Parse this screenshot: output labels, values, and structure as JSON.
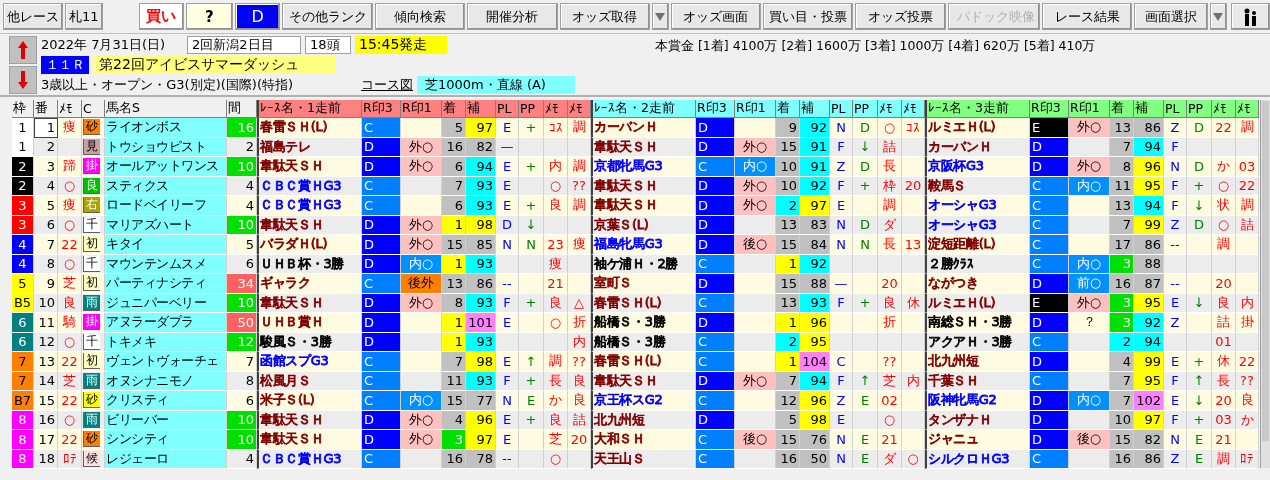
{
  "toolbar": {
    "buttons": [
      {
        "label": "他レース",
        "kind": "nav",
        "disabled": false
      },
      {
        "label": "札11",
        "kind": "nav",
        "disabled": false
      },
      {
        "label": "買い",
        "kind": "buy",
        "disabled": false
      },
      {
        "label": "?",
        "kind": "query",
        "disabled": false
      },
      {
        "label": "D",
        "kind": "rank",
        "disabled": false
      },
      {
        "label": "その他ランク",
        "kind": "wide",
        "disabled": false
      },
      {
        "label": "傾向検索",
        "kind": "wide",
        "disabled": false
      },
      {
        "label": "開催分析",
        "kind": "wide",
        "disabled": false
      },
      {
        "label": "オッズ取得",
        "kind": "wide",
        "disabled": false
      },
      {
        "kind": "dropdown",
        "disabled": false
      },
      {
        "label": "オッズ画面",
        "kind": "wide",
        "disabled": false
      },
      {
        "label": "買い目・投票",
        "kind": "wide",
        "disabled": false
      },
      {
        "label": "オッズ投票",
        "kind": "wide",
        "disabled": false
      },
      {
        "label": "パドック映像",
        "kind": "video",
        "disabled": true
      },
      {
        "label": "レース結果",
        "kind": "wide",
        "disabled": false
      },
      {
        "label": "画面選択",
        "kind": "select",
        "disabled": false
      },
      {
        "kind": "dropdown",
        "disabled": false
      },
      {
        "kind": "icon",
        "disabled": false
      }
    ]
  },
  "race": {
    "date": "2022年 7月31日(日)",
    "meeting": "2回新潟2日目",
    "runners": "18頭",
    "post_time": "15:45発走",
    "number": "１１Ｒ",
    "title": "第22回アイビスサマーダッシュ",
    "conditions": "3歳以上・オープン・G3(別定)(国際)(特指)",
    "course_link": "コース図",
    "course": "芝1000m・直線 (A)",
    "prize": "本賞金 [1着] 4100万 [2着] 1600万 [3着] 1000万 [4着] 620万 [5着] 410万"
  },
  "table": {
    "columns": [
      "枠",
      "番",
      "ﾒﾓ",
      "C",
      "馬名S",
      "間"
    ],
    "blocks": [
      {
        "color": "#ff8080",
        "columns": [
          "ﾚｰｽ名・1走前",
          "R印3",
          "R印1",
          "着",
          "補",
          "PL",
          "PP",
          "ﾒﾓ",
          "ﾒﾓ"
        ]
      },
      {
        "color": "#80ffff",
        "columns": [
          "ﾚｰｽ名・2走前",
          "R印3",
          "R印1",
          "着",
          "補",
          "PL",
          "PP",
          "ﾒﾓ",
          "ﾒﾓ"
        ]
      },
      {
        "color": "#80ff80",
        "columns": [
          "ﾚｰｽ名・3走前",
          "R印3",
          "R印1",
          "着",
          "補",
          "PL",
          "PP",
          "ﾒﾓ",
          "ﾒﾓ"
        ]
      }
    ],
    "rows": [
      {
        "frame": {
          "label": "1",
          "color": "#ffffff"
        },
        "num": "1",
        "selected": true,
        "memo": "痩",
        "badge": {
          "label": "砂",
          "color": "#ff8000"
        },
        "horse": "ライオンボス",
        "gap": {
          "label": "16",
          "color": "#00e000"
        },
        "runs": [
          {
            "race": {
              "label": "春雷ＳＨ(L)",
              "color": "#800000"
            },
            "rei3": "C",
            "place": {
              "label": "5",
              "color": "#c0c0c0"
            },
            "rating": {
              "label": "97",
              "color": "#ffff00"
            },
            "pl": "E",
            "pp": "+",
            "memo1": "ｺｽ",
            "memo2": "調"
          },
          {
            "race": {
              "label": "カーバンＨ",
              "color": "#800000"
            },
            "rei3": "D",
            "place": {
              "label": "9",
              "color": "#c0c0c0"
            },
            "rating": {
              "label": "92",
              "color": "#00ffff"
            },
            "pl": "N",
            "pp": "D",
            "memo1": "○",
            "memo2": "ｺｽ"
          },
          {
            "race": {
              "label": "ルミエＨ(L)",
              "color": "#800000"
            },
            "rei3": "E",
            "rei1": {
              "label": "外○",
              "color": "#ffc0c0"
            },
            "place": {
              "label": "13",
              "color": "#c0c0c0"
            },
            "rating": {
              "label": "86",
              "color": "#c0c0c0"
            },
            "pl": "Z",
            "pp": "D",
            "memo1": "22",
            "memo2": "調"
          }
        ]
      },
      {
        "frame": {
          "label": "1",
          "color": "#ffffff"
        },
        "num": "2",
        "selected": false,
        "badge": {
          "label": "見",
          "color": "#c8a0a0"
        },
        "horse": "トウショウピスト",
        "gap": {
          "label": "2"
        },
        "runs": [
          {
            "race": {
              "label": "福島テレ",
              "color": "#800000"
            },
            "rei3": "D",
            "rei1": {
              "label": "外○",
              "color": "#ffc0c0"
            },
            "place": {
              "label": "16",
              "color": "#c0c0c0"
            },
            "rating": {
              "label": "82",
              "color": "#c0c0c0"
            },
            "pl": "—"
          },
          {
            "race": {
              "label": "韋駄天ＳＨ",
              "color": "#800000"
            },
            "rei3": "D",
            "rei1": {
              "label": "外○",
              "color": "#ffc0c0"
            },
            "place": {
              "label": "15",
              "color": "#c0c0c0"
            },
            "rating": {
              "label": "91",
              "color": "#00ffff"
            },
            "pl": "F",
            "pp": "↓",
            "memo1": "詰"
          },
          {
            "race": {
              "label": "カーバンＨ",
              "color": "#800000"
            },
            "rei3": "D",
            "place": {
              "label": "7",
              "color": "#c0c0c0"
            },
            "rating": {
              "label": "94",
              "color": "#00ffff"
            },
            "pl": "F"
          }
        ]
      },
      {
        "frame": {
          "label": "2",
          "color": "#000000"
        },
        "num": "3",
        "selected": false,
        "memo": "蹄",
        "badge": {
          "label": "掛",
          "color": "#ff00ff"
        },
        "horse": "オールアットワンス",
        "gap": {
          "label": "10",
          "color": "#00e000"
        },
        "runs": [
          {
            "race": {
              "label": "韋駄天ＳＨ",
              "color": "#800000"
            },
            "rei3": "D",
            "rei1": {
              "label": "外○",
              "color": "#ffc0c0"
            },
            "place": {
              "label": "6",
              "color": "#c0c0c0"
            },
            "rating": {
              "label": "94",
              "color": "#00ffff"
            },
            "pl": "E",
            "pp": "+",
            "memo1": "内",
            "memo2": "調"
          },
          {
            "race": {
              "label": "京都牝馬G3",
              "color": "#0000ff"
            },
            "rei3": "C",
            "rei1": {
              "label": "内○",
              "color": "#0090ff"
            },
            "place": {
              "label": "10",
              "color": "#c0c0c0"
            },
            "rating": {
              "label": "91",
              "color": "#00ffff"
            },
            "pl": "Z",
            "pp": "D",
            "memo1": "長"
          },
          {
            "race": {
              "label": "京阪杯G3",
              "color": "#0000ff"
            },
            "rei3": "D",
            "rei1": {
              "label": "外○",
              "color": "#ffc0c0"
            },
            "place": {
              "label": "8",
              "color": "#c0c0c0"
            },
            "rating": {
              "label": "96",
              "color": "#ffff00"
            },
            "pl": "N",
            "pp": "D",
            "memo1": "か",
            "memo2": "03"
          }
        ]
      },
      {
        "frame": {
          "label": "2",
          "color": "#000000"
        },
        "num": "4",
        "selected": false,
        "memo": "○",
        "badge": {
          "label": "良",
          "color": "#00c000"
        },
        "horse": "スティクス",
        "gap": {
          "label": "4"
        },
        "runs": [
          {
            "race": {
              "label": "ＣＢＣ賞ＨG3",
              "color": "#0000ff"
            },
            "rei3": "C",
            "place": {
              "label": "7",
              "color": "#c0c0c0"
            },
            "rating": {
              "label": "93",
              "color": "#00ffff"
            },
            "pl": "E",
            "memo1": "○",
            "memo2": "??"
          },
          {
            "race": {
              "label": "韋駄天ＳＨ",
              "color": "#800000"
            },
            "rei3": "D",
            "rei1": {
              "label": "外○",
              "color": "#ffc0c0"
            },
            "place": {
              "label": "10",
              "color": "#c0c0c0"
            },
            "rating": {
              "label": "92",
              "color": "#00ffff"
            },
            "pl": "F",
            "pp": "+",
            "memo1": "枠",
            "memo2": "20"
          },
          {
            "race": {
              "label": "鞍馬Ｓ",
              "color": "#800000"
            },
            "rei3": "C",
            "rei1": {
              "label": "内○",
              "color": "#0090ff"
            },
            "place": {
              "label": "11",
              "color": "#c0c0c0"
            },
            "rating": {
              "label": "95",
              "color": "#ffff00"
            },
            "pl": "F",
            "pp": "+",
            "memo1": "○",
            "memo2": "22"
          }
        ]
      },
      {
        "frame": {
          "label": "3",
          "color": "#ff0000"
        },
        "num": "5",
        "selected": false,
        "memo": "痩",
        "badge": {
          "label": "右",
          "color": "#b0a000"
        },
        "horse": "ロードベイリーフ",
        "gap": {
          "label": "4"
        },
        "runs": [
          {
            "race": {
              "label": "ＣＢＣ賞ＨG3",
              "color": "#0000ff"
            },
            "rei3": "C",
            "place": {
              "label": "6",
              "color": "#c0c0c0"
            },
            "rating": {
              "label": "93",
              "color": "#00ffff"
            },
            "pl": "E",
            "pp": "+",
            "memo1": "良",
            "memo2": "調"
          },
          {
            "race": {
              "label": "韋駄天ＳＨ",
              "color": "#800000"
            },
            "rei3": "D",
            "rei1": {
              "label": "外○",
              "color": "#ffc0c0"
            },
            "place": {
              "label": "2",
              "color": "#00ffff"
            },
            "rating": {
              "label": "97",
              "color": "#ffff00"
            },
            "pl": "E",
            "memo1": "調"
          },
          {
            "race": {
              "label": "オーシャG3",
              "color": "#0000ff"
            },
            "rei3": "C",
            "place": {
              "label": "13",
              "color": "#c0c0c0"
            },
            "rating": {
              "label": "94",
              "color": "#00ffff"
            },
            "pl": "F",
            "pp": "↓",
            "memo1": "状",
            "memo2": "調"
          }
        ]
      },
      {
        "frame": {
          "label": "3",
          "color": "#ff0000"
        },
        "num": "6",
        "selected": false,
        "memo": "○",
        "badge": {
          "label": "千",
          "color": "#ffffff"
        },
        "horse": "マリアズハート",
        "gap": {
          "label": "10",
          "color": "#00e000"
        },
        "runs": [
          {
            "race": {
              "label": "韋駄天ＳＨ",
              "color": "#800000"
            },
            "rei3": "D",
            "rei1": {
              "label": "外○",
              "color": "#ffc0c0"
            },
            "place": {
              "label": "1",
              "color": "#ffff00"
            },
            "rating": {
              "label": "98",
              "color": "#ffff00"
            },
            "pl": "D",
            "pp": "↓"
          },
          {
            "race": {
              "label": "京葉Ｓ(L)",
              "color": "#800000"
            },
            "rei3": "D",
            "place": {
              "label": "13",
              "color": "#c0c0c0"
            },
            "rating": {
              "label": "83",
              "color": "#c0c0c0"
            },
            "pl": "N",
            "pp": "D",
            "memo1": "ダ"
          },
          {
            "race": {
              "label": "オーシャG3",
              "color": "#0000ff"
            },
            "rei3": "C",
            "place": {
              "label": "7",
              "color": "#c0c0c0"
            },
            "rating": {
              "label": "99",
              "color": "#ffff00"
            },
            "pl": "Z",
            "pp": "D",
            "memo1": "○",
            "memo2": "詰"
          }
        ]
      },
      {
        "frame": {
          "label": "4",
          "color": "#0000ff"
        },
        "num": "7",
        "selected": false,
        "memo": "22",
        "badge": {
          "label": "初",
          "color": "#ffffc0"
        },
        "horse": "キタイ",
        "gap": {
          "label": "5"
        },
        "runs": [
          {
            "race": {
              "label": "バラダＨ(L)",
              "color": "#800000"
            },
            "rei3": "D",
            "rei1": {
              "label": "外○",
              "color": "#ffc0c0"
            },
            "place": {
              "label": "15",
              "color": "#c0c0c0"
            },
            "rating": {
              "label": "85",
              "color": "#c0c0c0"
            },
            "pl": "N",
            "pp": "N",
            "memo1": "23",
            "memo2": "痩"
          },
          {
            "race": {
              "label": "福島牝馬G3",
              "color": "#0000ff"
            },
            "rei3": "D",
            "rei1": {
              "label": "後○",
              "color": "#ffc0c0"
            },
            "place": {
              "label": "15",
              "color": "#c0c0c0"
            },
            "rating": {
              "label": "84",
              "color": "#c0c0c0"
            },
            "pl": "N",
            "pp": "N",
            "memo1": "長",
            "memo2": "13"
          },
          {
            "race": {
              "label": "淀短距離(L)",
              "color": "#800000"
            },
            "rei3": "C",
            "place": {
              "label": "17",
              "color": "#c0c0c0"
            },
            "rating": {
              "label": "86",
              "color": "#c0c0c0"
            },
            "pl": "--",
            "memo1": "調"
          }
        ]
      },
      {
        "frame": {
          "label": "4",
          "color": "#0000ff"
        },
        "num": "8",
        "selected": false,
        "memo": "○",
        "badge": {
          "label": "千",
          "color": "#ffffff"
        },
        "horse": "マウンテンムスメ",
        "gap": {
          "label": "6"
        },
        "runs": [
          {
            "race": {
              "label": "ＵＨＢ杯・3勝",
              "color": "#000000"
            },
            "rei3": "D",
            "rei1": {
              "label": "内○",
              "color": "#0090ff"
            },
            "place": {
              "label": "1",
              "color": "#ffff00"
            },
            "rating": {
              "label": "93",
              "color": "#00ffff"
            },
            "memo1": "痩"
          },
          {
            "race": {
              "label": "袖ケ浦Ｈ・2勝",
              "color": "#000000"
            },
            "rei3": "C",
            "place": {
              "label": "1",
              "color": "#ffff00"
            },
            "rating": {
              "label": "92",
              "color": "#00ffff"
            }
          },
          {
            "race": {
              "label": "２勝ｸﾗｽ",
              "color": "#000000"
            },
            "rei3": "C",
            "rei1": {
              "label": "内○",
              "color": "#0090ff"
            },
            "place": {
              "label": "3",
              "color": "#00e000"
            },
            "rating": {
              "label": "88",
              "color": "#c0c0c0"
            }
          }
        ]
      },
      {
        "frame": {
          "label": "5",
          "color": "#ffff00"
        },
        "num": "9",
        "selected": false,
        "memo": "芝",
        "badge": {
          "label": "初",
          "color": "#ffffc0"
        },
        "horse": "パーティナシティ",
        "gap": {
          "label": "34",
          "color": "#ff6060"
        },
        "runs": [
          {
            "race": {
              "label": "ギャラク",
              "color": "#800000"
            },
            "rei3": "C",
            "rei1": {
              "label": "後外",
              "color": "#ff8000"
            },
            "place": {
              "label": "13",
              "color": "#c0c0c0"
            },
            "rating": {
              "label": "86",
              "color": "#c0c0c0"
            },
            "pl": "--",
            "memo1": "21"
          },
          {
            "race": {
              "label": "室町Ｓ",
              "color": "#800000"
            },
            "rei3": "D",
            "place": {
              "label": "15",
              "color": "#c0c0c0"
            },
            "rating": {
              "label": "88",
              "color": "#c0c0c0"
            },
            "pl": "—",
            "memo1": "20"
          },
          {
            "race": {
              "label": "ながつき",
              "color": "#800000"
            },
            "rei3": "D",
            "rei1": {
              "label": "前○",
              "color": "#0090ff"
            },
            "place": {
              "label": "16",
              "color": "#c0c0c0"
            },
            "rating": {
              "label": "87",
              "color": "#c0c0c0"
            },
            "pl": "--",
            "memo1": "20"
          }
        ]
      },
      {
        "frame": {
          "label": "B5",
          "color": "#ffff00"
        },
        "num": "10",
        "selected": false,
        "memo": "良",
        "badge": {
          "label": "雨",
          "color": "#008080"
        },
        "horse": "ジュニパーベリー",
        "gap": {
          "label": "10",
          "color": "#00e000"
        },
        "runs": [
          {
            "race": {
              "label": "韋駄天ＳＨ",
              "color": "#800000"
            },
            "rei3": "D",
            "rei1": {
              "label": "外○",
              "color": "#ffc0c0"
            },
            "place": {
              "label": "8",
              "color": "#c0c0c0"
            },
            "rating": {
              "label": "93",
              "color": "#00ffff"
            },
            "pl": "F",
            "pp": "+",
            "memo1": "良",
            "memo2": "△"
          },
          {
            "race": {
              "label": "春雷ＳＨ(L)",
              "color": "#800000"
            },
            "rei3": "C",
            "place": {
              "label": "13",
              "color": "#c0c0c0"
            },
            "rating": {
              "label": "93",
              "color": "#00ffff"
            },
            "pl": "F",
            "pp": "+",
            "memo1": "良",
            "memo2": "休"
          },
          {
            "race": {
              "label": "ルミエＨ(L)",
              "color": "#800000"
            },
            "rei3": "E",
            "rei1": {
              "label": "外○",
              "color": "#ffc0c0"
            },
            "place": {
              "label": "3",
              "color": "#00e000"
            },
            "rating": {
              "label": "95",
              "color": "#ffff00"
            },
            "pl": "E",
            "pp": "↓",
            "memo1": "良",
            "memo2": "内"
          }
        ]
      },
      {
        "frame": {
          "label": "6",
          "color": "#008080"
        },
        "num": "11",
        "selected": false,
        "memo": "騎",
        "badge": {
          "label": "掛",
          "color": "#ff00ff"
        },
        "horse": "アヌラーダプラ",
        "gap": {
          "label": "50",
          "color": "#ff6060"
        },
        "runs": [
          {
            "race": {
              "label": "ＵＨＢ賞Ｈ",
              "color": "#800000"
            },
            "rei3": "D",
            "place": {
              "label": "1",
              "color": "#ffff00"
            },
            "rating": {
              "label": "101",
              "color": "#ff80ff"
            },
            "pl": "E",
            "memo1": "○",
            "memo2": "折"
          },
          {
            "race": {
              "label": "船橋Ｓ・3勝",
              "color": "#000000"
            },
            "rei3": "D",
            "place": {
              "label": "1",
              "color": "#ffff00"
            },
            "rating": {
              "label": "96",
              "color": "#ffff00"
            },
            "memo1": "折"
          },
          {
            "race": {
              "label": "南総ＳＨ・3勝",
              "color": "#000000"
            },
            "rei3": "D",
            "rei1": {
              "label": "？"
            },
            "place": {
              "label": "3",
              "color": "#00e000"
            },
            "rating": {
              "label": "92",
              "color": "#00ffff"
            },
            "pl": "Z",
            "memo1": "詰",
            "memo2": "掛"
          }
        ]
      },
      {
        "frame": {
          "label": "6",
          "color": "#008080"
        },
        "num": "12",
        "selected": false,
        "memo": "○",
        "badge": {
          "label": "千",
          "color": "#ffffff"
        },
        "horse": "トキメキ",
        "gap": {
          "label": "12",
          "color": "#00e000"
        },
        "runs": [
          {
            "race": {
              "label": "駿風Ｓ・3勝",
              "color": "#000000"
            },
            "rei3": "D",
            "place": {
              "label": "1",
              "color": "#ffff00"
            },
            "rating": {
              "label": "93",
              "color": "#00ffff"
            },
            "memo2": "内"
          },
          {
            "race": {
              "label": "船橋Ｓ・3勝",
              "color": "#000000"
            },
            "rei3": "C",
            "place": {
              "label": "2",
              "color": "#00ffff"
            },
            "rating": {
              "label": "95",
              "color": "#ffff00"
            }
          },
          {
            "race": {
              "label": "アクアＨ・3勝",
              "color": "#000000"
            },
            "rei3": "C",
            "place": {
              "label": "2",
              "color": "#00ffff"
            },
            "rating": {
              "label": "94",
              "color": "#00ffff"
            },
            "memo1": "01"
          }
        ]
      },
      {
        "frame": {
          "label": "7",
          "color": "#ff8000"
        },
        "num": "13",
        "selected": false,
        "memo": "22",
        "badge": {
          "label": "初",
          "color": "#ffffc0"
        },
        "horse": "ヴェントヴォーチェ",
        "gap": {
          "label": "7"
        },
        "runs": [
          {
            "race": {
              "label": "函館スプG3",
              "color": "#0000ff"
            },
            "rei3": "C",
            "place": {
              "label": "7",
              "color": "#c0c0c0"
            },
            "rating": {
              "label": "98",
              "color": "#ffff00"
            },
            "pl": "E",
            "pp": "↑",
            "memo1": "調",
            "memo2": "??"
          },
          {
            "race": {
              "label": "春雷ＳＨ(L)",
              "color": "#800000"
            },
            "rei3": "C",
            "place": {
              "label": "1",
              "color": "#ffff00"
            },
            "rating": {
              "label": "104",
              "color": "#ff80ff"
            },
            "pl": "C",
            "memo1": "??"
          },
          {
            "race": {
              "label": "北九州短",
              "color": "#800000"
            },
            "rei3": "D",
            "place": {
              "label": "4",
              "color": "#c0c0c0"
            },
            "rating": {
              "label": "99",
              "color": "#ffff00"
            },
            "pl": "E",
            "pp": "+",
            "memo1": "休",
            "memo2": "22"
          }
        ]
      },
      {
        "frame": {
          "label": "7",
          "color": "#ff8000"
        },
        "num": "14",
        "selected": false,
        "memo": "芝",
        "badge": {
          "label": "雨",
          "color": "#008080"
        },
        "horse": "オヌシナニモノ",
        "gap": {
          "label": "8"
        },
        "runs": [
          {
            "race": {
              "label": "松風月Ｓ",
              "color": "#800000"
            },
            "rei3": "C",
            "place": {
              "label": "11",
              "color": "#c0c0c0"
            },
            "rating": {
              "label": "93",
              "color": "#00ffff"
            },
            "pl": "F",
            "pp": "+",
            "memo1": "長",
            "memo2": "良"
          },
          {
            "race": {
              "label": "韋駄天ＳＨ",
              "color": "#800000"
            },
            "rei3": "D",
            "rei1": {
              "label": "外○",
              "color": "#ffc0c0"
            },
            "place": {
              "label": "7",
              "color": "#c0c0c0"
            },
            "rating": {
              "label": "94",
              "color": "#00ffff"
            },
            "pl": "F",
            "pp": "↑",
            "memo1": "芝",
            "memo2": "内"
          },
          {
            "race": {
              "label": "千葉ＳＨ",
              "color": "#800000"
            },
            "rei3": "C",
            "place": {
              "label": "7",
              "color": "#c0c0c0"
            },
            "rating": {
              "label": "95",
              "color": "#ffff00"
            },
            "pl": "F",
            "pp": "↑",
            "memo1": "長",
            "memo2": "??"
          }
        ]
      },
      {
        "frame": {
          "label": "B7",
          "color": "#ff8000"
        },
        "num": "15",
        "selected": false,
        "memo": "22",
        "badge": {
          "label": "砂",
          "color": "#ffff00"
        },
        "horse": "クリスティ",
        "gap": {
          "label": "6"
        },
        "runs": [
          {
            "race": {
              "label": "米子Ｓ(L)",
              "color": "#800000"
            },
            "rei3": "C",
            "rei1": {
              "label": "内○",
              "color": "#0090ff"
            },
            "place": {
              "label": "15",
              "color": "#c0c0c0"
            },
            "rating": {
              "label": "77",
              "color": "#c0c0c0"
            },
            "pl": "N",
            "pp": "E",
            "memo1": "か",
            "memo2": "良"
          },
          {
            "race": {
              "label": "京王杯スG2",
              "color": "#0000ff"
            },
            "rei3": "C",
            "place": {
              "label": "12",
              "color": "#c0c0c0"
            },
            "rating": {
              "label": "96",
              "color": "#ffff00"
            },
            "pl": "Z",
            "pp": "E",
            "memo1": "02"
          },
          {
            "race": {
              "label": "阪神牝馬G2",
              "color": "#0000ff"
            },
            "rei3": "D",
            "rei1": {
              "label": "内○",
              "color": "#0090ff"
            },
            "place": {
              "label": "7",
              "color": "#c0c0c0"
            },
            "rating": {
              "label": "102",
              "color": "#ff80ff"
            },
            "pl": "E",
            "pp": "↓",
            "memo1": "20",
            "memo2": "良"
          }
        ]
      },
      {
        "frame": {
          "label": "8",
          "color": "#ff00ff"
        },
        "num": "16",
        "selected": false,
        "memo": "○",
        "badge": {
          "label": "雨",
          "color": "#008080"
        },
        "horse": "ビリーバー",
        "gap": {
          "label": "10",
          "color": "#00e000"
        },
        "runs": [
          {
            "race": {
              "label": "韋駄天ＳＨ",
              "color": "#800000"
            },
            "rei3": "D",
            "rei1": {
              "label": "外○",
              "color": "#ffc0c0"
            },
            "place": {
              "label": "4",
              "color": "#c0c0c0"
            },
            "rating": {
              "label": "96",
              "color": "#ffff00"
            },
            "pl": "E",
            "pp": "+",
            "memo1": "良",
            "memo2": "詰"
          },
          {
            "race": {
              "label": "北九州短",
              "color": "#800000"
            },
            "rei3": "D",
            "place": {
              "label": "5",
              "color": "#c0c0c0"
            },
            "rating": {
              "label": "98",
              "color": "#ffff00"
            },
            "pl": "E",
            "memo1": "○"
          },
          {
            "race": {
              "label": "タンザナＨ",
              "color": "#800000"
            },
            "rei3": "D",
            "place": {
              "label": "10",
              "color": "#c0c0c0"
            },
            "rating": {
              "label": "97",
              "color": "#ffff00"
            },
            "pl": "F",
            "pp": "+",
            "memo1": "03",
            "memo2": "か"
          }
        ]
      },
      {
        "frame": {
          "label": "8",
          "color": "#ff00ff"
        },
        "num": "17",
        "selected": false,
        "memo": "22",
        "badge": {
          "label": "砂",
          "color": "#ff8000"
        },
        "horse": "シンシティ",
        "gap": {
          "label": "10",
          "color": "#00e000"
        },
        "runs": [
          {
            "race": {
              "label": "韋駄天ＳＨ",
              "color": "#800000"
            },
            "rei3": "D",
            "rei1": {
              "label": "外○",
              "color": "#ffc0c0"
            },
            "place": {
              "label": "3",
              "color": "#00e000"
            },
            "rating": {
              "label": "97",
              "color": "#ffff00"
            },
            "pl": "E",
            "memo1": "芝",
            "memo2": "20"
          },
          {
            "race": {
              "label": "大和ＳＨ",
              "color": "#800000"
            },
            "rei3": "C",
            "rei1": {
              "label": "後○",
              "color": "#ffc0c0"
            },
            "place": {
              "label": "15",
              "color": "#c0c0c0"
            },
            "rating": {
              "label": "76",
              "color": "#c0c0c0"
            },
            "pl": "N",
            "pp": "E",
            "memo1": "21"
          },
          {
            "race": {
              "label": "ジャニュ",
              "color": "#800000"
            },
            "rei3": "D",
            "rei1": {
              "label": "後○",
              "color": "#ffc0c0"
            },
            "place": {
              "label": "15",
              "color": "#c0c0c0"
            },
            "rating": {
              "label": "82",
              "color": "#c0c0c0"
            },
            "pl": "N",
            "pp": "E",
            "memo1": "21"
          }
        ]
      },
      {
        "frame": {
          "label": "8",
          "color": "#ff00ff"
        },
        "num": "18",
        "selected": false,
        "memo": "ﾛﾃ",
        "badge": {
          "label": "候",
          "color": "#ffe0e0"
        },
        "horse": "レジェーロ",
        "gap": {
          "label": "4"
        },
        "runs": [
          {
            "race": {
              "label": "ＣＢＣ賞ＨG3",
              "color": "#0000ff"
            },
            "rei3": "C",
            "place": {
              "label": "16",
              "color": "#c0c0c0"
            },
            "rating": {
              "label": "78",
              "color": "#c0c0c0"
            },
            "pl": "--",
            "memo1": "○"
          },
          {
            "race": {
              "label": "天王山Ｓ",
              "color": "#800000"
            },
            "rei3": "C",
            "place": {
              "label": "16",
              "color": "#c0c0c0"
            },
            "rating": {
              "label": "50",
              "color": "#c0c0c0"
            },
            "pl": "N",
            "pp": "E",
            "memo1": "ダ",
            "memo2": "○"
          },
          {
            "race": {
              "label": "シルクロＨG3",
              "color": "#0000ff"
            },
            "rei3": "C",
            "place": {
              "label": "16",
              "color": "#c0c0c0"
            },
            "rating": {
              "label": "86",
              "color": "#c0c0c0"
            },
            "pl": "Z",
            "pp": "E",
            "memo1": "調",
            "memo2": "ﾛﾃ"
          }
        ]
      }
    ]
  }
}
